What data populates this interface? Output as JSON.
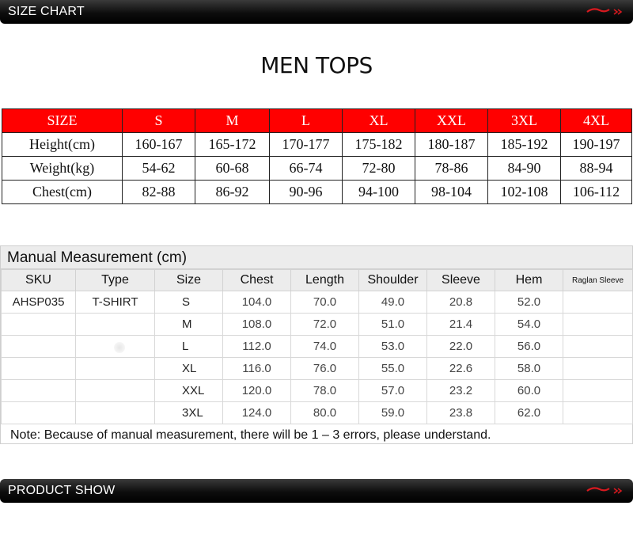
{
  "header": {
    "title": "SIZE CHART"
  },
  "footer": {
    "title": "PRODUCT SHOW"
  },
  "brand_color": "#d7191f",
  "section_title": "MEN TOPS",
  "size_table": {
    "header": [
      "SIZE",
      "S",
      "M",
      "L",
      "XL",
      "XXL",
      "3XL",
      "4XL"
    ],
    "rows": [
      [
        "Height(cm)",
        "160-167",
        "165-172",
        "170-177",
        "175-182",
        "180-187",
        "185-192",
        "190-197"
      ],
      [
        "Weight(kg)",
        "54-62",
        "60-68",
        "66-74",
        "72-80",
        "78-86",
        "84-90",
        "88-94"
      ],
      [
        "Chest(cm)",
        "82-88",
        "86-92",
        "90-96",
        "94-100",
        "98-104",
        "102-108",
        "106-112"
      ]
    ]
  },
  "manual": {
    "title": "Manual Measurement (cm)",
    "columns": [
      "SKU",
      "Type",
      "Size",
      "Chest",
      "Length",
      "Shoulder",
      "Sleeve",
      "Hem",
      "Raglan Sleeve"
    ],
    "rows": [
      [
        "AHSP035",
        "T-SHIRT",
        "S",
        "104.0",
        "70.0",
        "49.0",
        "20.8",
        "52.0",
        ""
      ],
      [
        "",
        "",
        "M",
        "108.0",
        "72.0",
        "51.0",
        "21.4",
        "54.0",
        ""
      ],
      [
        "",
        "",
        "L",
        "112.0",
        "74.0",
        "53.0",
        "22.0",
        "56.0",
        ""
      ],
      [
        "",
        "",
        "XL",
        "116.0",
        "76.0",
        "55.0",
        "22.6",
        "58.0",
        ""
      ],
      [
        "",
        "",
        "XXL",
        "120.0",
        "78.0",
        "57.0",
        "23.2",
        "60.0",
        ""
      ],
      [
        "",
        "",
        "3XL",
        "124.0",
        "80.0",
        "59.0",
        "23.8",
        "62.0",
        ""
      ]
    ],
    "note": "Note: Because of manual measurement, there will be 1 – 3 errors, please understand."
  }
}
